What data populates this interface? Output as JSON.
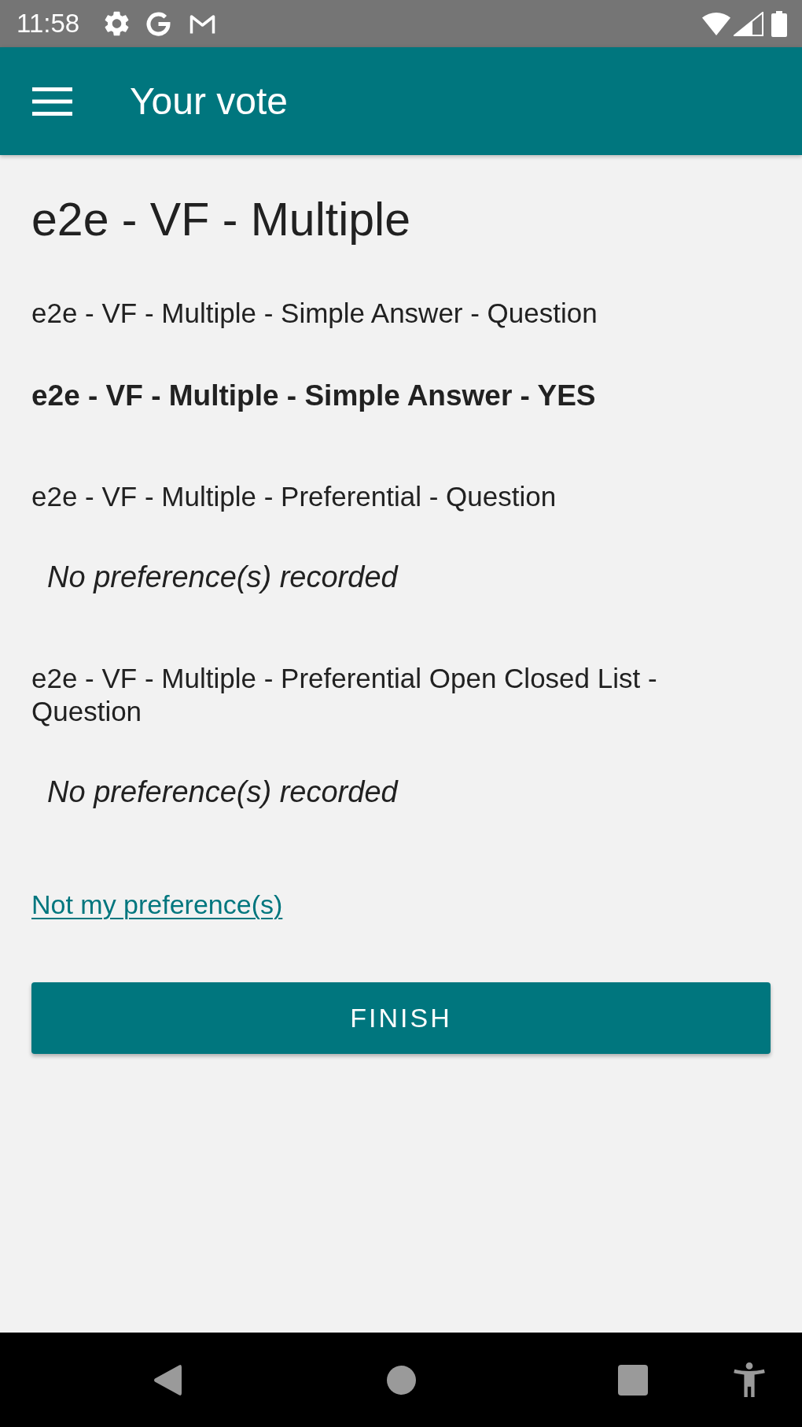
{
  "status_bar": {
    "time": "11:58"
  },
  "app_bar": {
    "title": "Your vote"
  },
  "ballot": {
    "title": "e2e - VF - Multiple",
    "questions": [
      {
        "question": "e2e - VF - Multiple - Simple Answer - Question",
        "answer": {
          "kind": "choice",
          "text": "e2e - VF - Multiple - Simple Answer - YES"
        }
      },
      {
        "question": "e2e - VF - Multiple - Preferential - Question",
        "answer": {
          "kind": "none",
          "text": "No preference(s) recorded"
        }
      },
      {
        "question": "e2e - VF - Multiple - Preferential Open Closed List - Question",
        "answer": {
          "kind": "none",
          "text": "No preference(s) recorded"
        }
      }
    ]
  },
  "link": {
    "label": "Not my preference(s)"
  },
  "finish_button": {
    "label": "FINISH"
  }
}
